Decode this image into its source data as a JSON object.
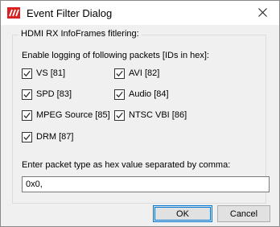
{
  "window": {
    "title": "Event Filter Dialog",
    "app_icon": "app-logo-icon",
    "close_icon": "close-icon",
    "accent_color": "#d82020"
  },
  "group": {
    "label": "HDMI RX InfoFrames fitlering:"
  },
  "instructions": {
    "packets_label": "Enable logging of following packets [IDs in hex]:",
    "hex_label": "Enter packet type as hex value separated by comma:"
  },
  "packets": [
    {
      "label": "VS [81]",
      "checked": true
    },
    {
      "label": "AVI [82]",
      "checked": true
    },
    {
      "label": "SPD [83]",
      "checked": true
    },
    {
      "label": "Audio [84]",
      "checked": true
    },
    {
      "label": "MPEG Source [85]",
      "checked": true
    },
    {
      "label": "NTSC VBI [86]",
      "checked": true
    },
    {
      "label": "DRM [87]",
      "checked": true
    }
  ],
  "hex_input": {
    "value": "0x0,"
  },
  "buttons": {
    "ok": "OK",
    "cancel": "Cancel"
  }
}
